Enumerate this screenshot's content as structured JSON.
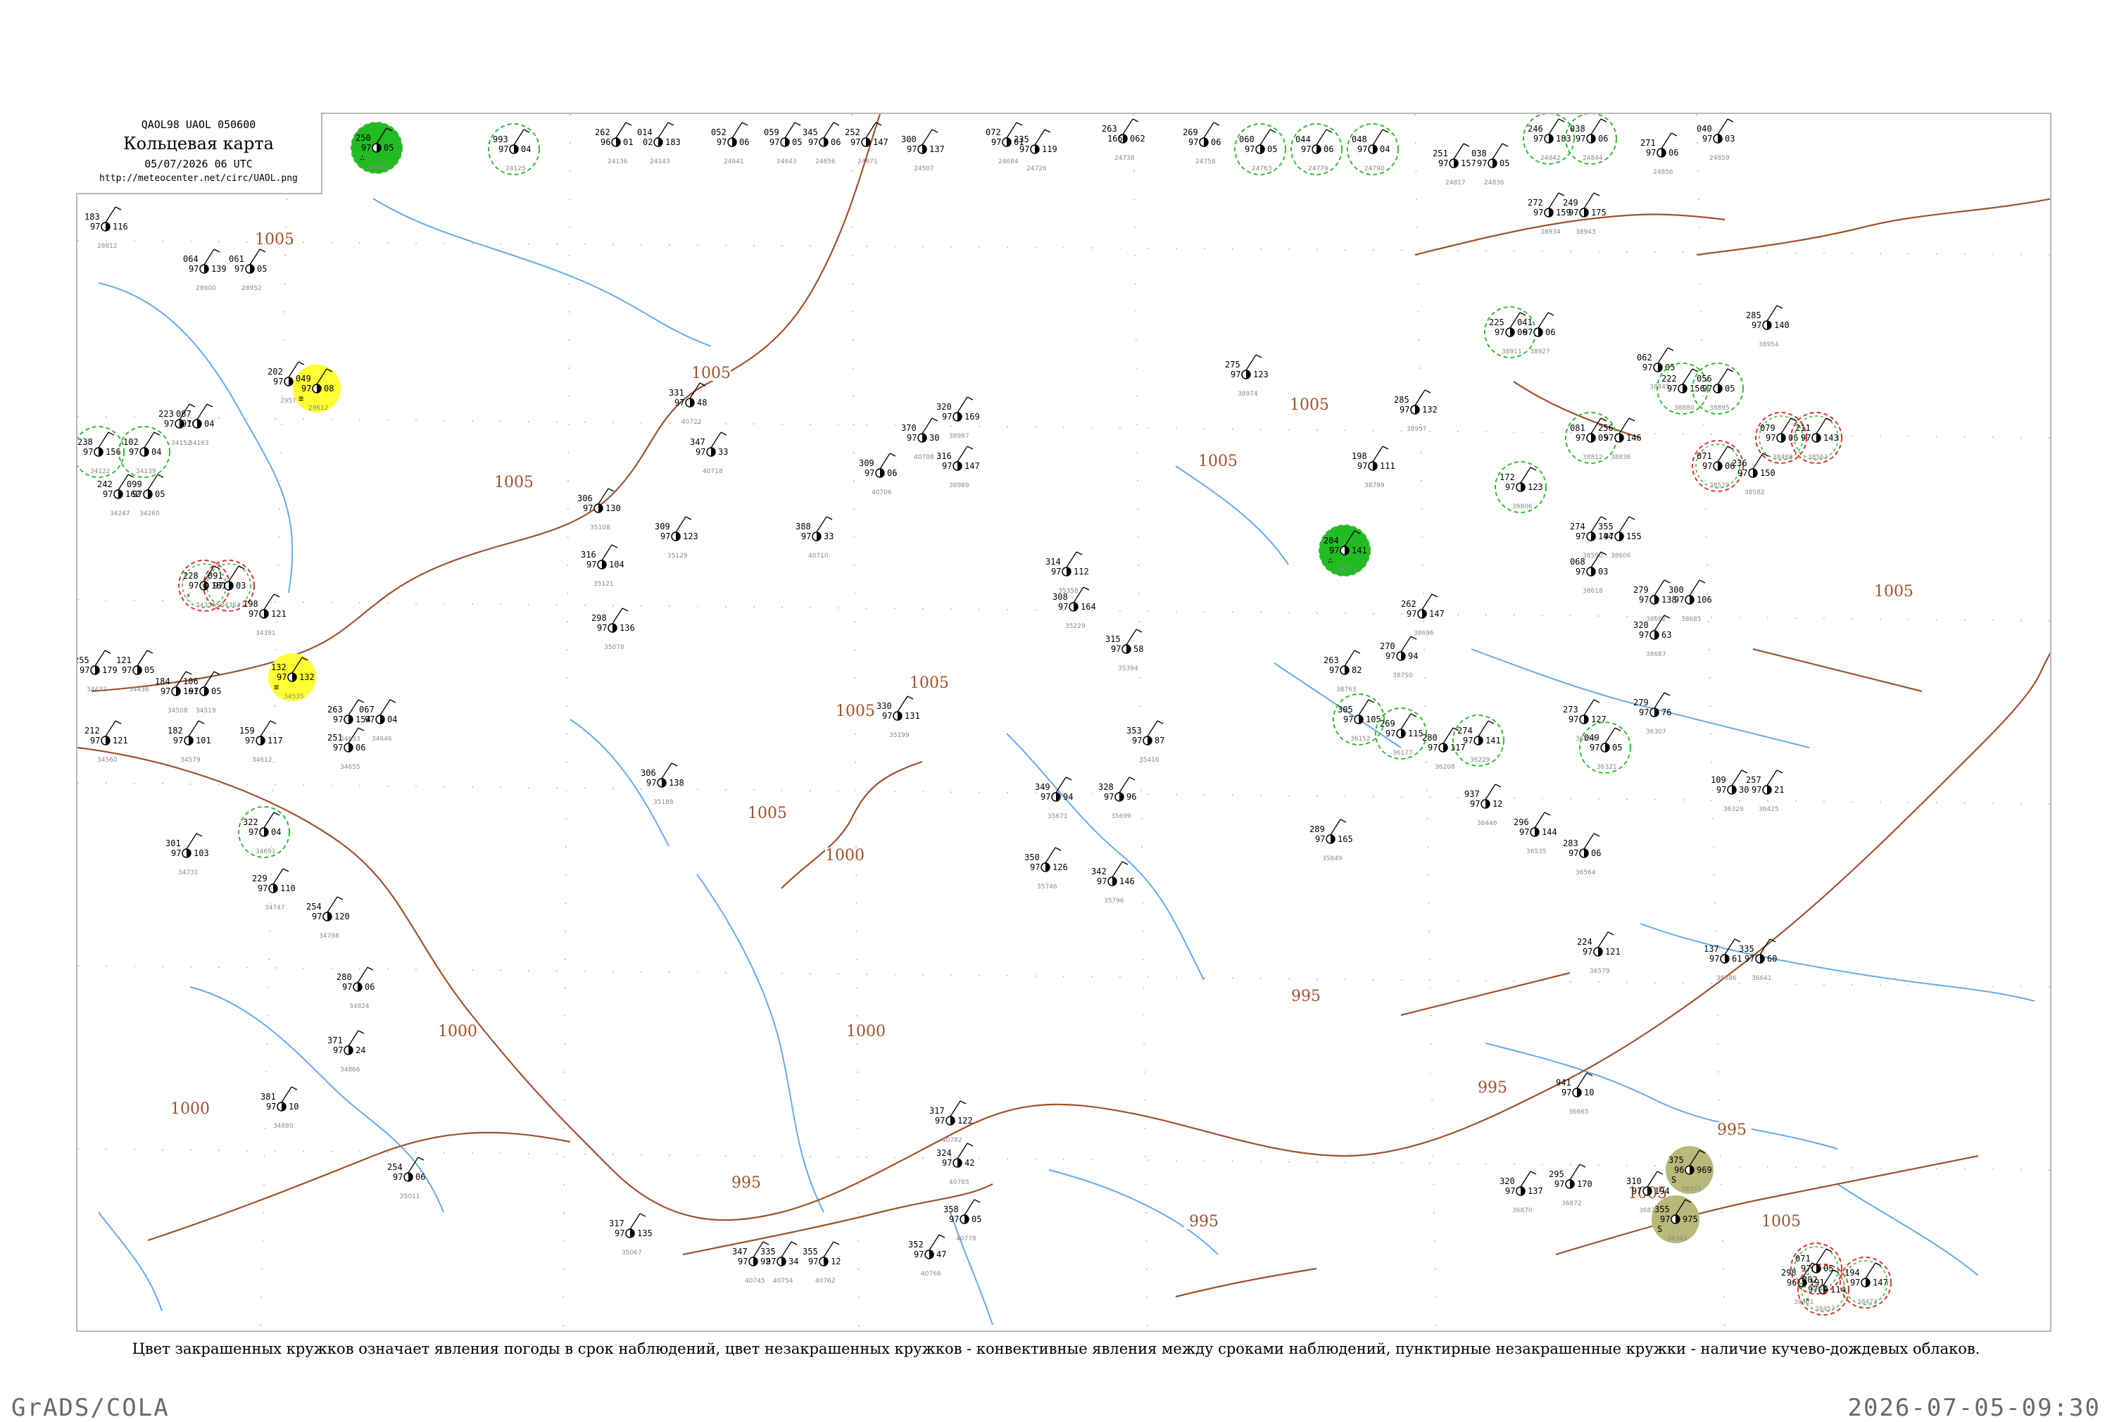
{
  "title": {
    "code": "QAOL98  UAOL  050600",
    "main": "Кольцевая карта",
    "time": "05/07/2026 06 UTC",
    "url": "http://meteocenter.net/circ/UAOL.png"
  },
  "caption": "Цвет закрашенных кружков означает явления погоды в срок наблюдений, цвет незакрашенных кружков - конвективные явления между сроками наблюдений, пунктирные незакрашенные кружки - наличие кучево-дождевых облаков.",
  "footer": {
    "left": "GrADS/COLA",
    "right": "2026-07-05-09:30"
  },
  "colors": {
    "rain_fill": "#22bb22",
    "convective_ring": "#33bb33",
    "thunder_ring": "#dd3333",
    "fog_fill": "#ffff33",
    "dust_fill": "#b8b87a",
    "isobar": "#a0522d",
    "river": "#66aaee",
    "frame": "#b8b8b8"
  },
  "isobar_labels": [
    "1005",
    "1005",
    "1005",
    "1005",
    "1005",
    "1005",
    "1005",
    "1005",
    "1005",
    "1000",
    "1000",
    "1000",
    "1000",
    "995",
    "995",
    "995",
    "995",
    "995",
    "1005",
    "1005"
  ],
  "stations": [
    {
      "p": "250",
      "t": "97",
      "v": "05",
      "id": "23955",
      "w": "rain",
      "kind": "rain"
    },
    {
      "p": "993",
      "t": "97",
      "v": "04",
      "id": "24125",
      "w": "",
      "kind": "conv"
    },
    {
      "p": "262",
      "t": "96",
      "v": "01",
      "id": "24136",
      "w": "",
      "kind": "none"
    },
    {
      "p": "014",
      "t": "02",
      "v": "183",
      "id": "24143",
      "w": "",
      "kind": "none"
    },
    {
      "p": "300",
      "t": "97",
      "v": "137",
      "id": "24507",
      "w": "",
      "kind": "none"
    },
    {
      "p": "052",
      "t": "97",
      "v": "06",
      "id": "24641",
      "w": "",
      "kind": "none"
    },
    {
      "p": "059",
      "t": "97",
      "v": "05",
      "id": "24643",
      "w": "",
      "kind": "none"
    },
    {
      "p": "345",
      "t": "97",
      "v": "06",
      "id": "24656",
      "w": "",
      "kind": "none"
    },
    {
      "p": "252",
      "t": "97",
      "v": "147",
      "id": "24671",
      "w": "",
      "kind": "none"
    },
    {
      "p": "072",
      "t": "97",
      "v": "01",
      "id": "24684",
      "w": "",
      "kind": "none"
    },
    {
      "p": "235",
      "t": "97",
      "v": "119",
      "id": "24726",
      "w": "",
      "kind": "none"
    },
    {
      "p": "263",
      "t": "166",
      "v": "062",
      "id": "24738",
      "w": "",
      "kind": "none"
    },
    {
      "p": "269",
      "t": "97",
      "v": "06",
      "id": "24758",
      "w": "",
      "kind": "none"
    },
    {
      "p": "060",
      "t": "97",
      "v": "05",
      "id": "24763",
      "w": "",
      "kind": "conv"
    },
    {
      "p": "044",
      "t": "97",
      "v": "06",
      "id": "24779",
      "w": "",
      "kind": "conv"
    },
    {
      "p": "048",
      "t": "97",
      "v": "04",
      "id": "24790",
      "w": "",
      "kind": "conv"
    },
    {
      "p": "251",
      "t": "97",
      "v": "157",
      "id": "24817",
      "w": "",
      "kind": "none"
    },
    {
      "p": "038",
      "t": "97",
      "v": "05",
      "id": "24836",
      "w": "",
      "kind": "none"
    },
    {
      "p": "246",
      "t": "97",
      "v": "183",
      "id": "24842",
      "w": "",
      "kind": "conv"
    },
    {
      "p": "038",
      "t": "97",
      "v": "06",
      "id": "24844",
      "w": "",
      "kind": "conv"
    },
    {
      "p": "271",
      "t": "97",
      "v": "06",
      "id": "24856",
      "w": "",
      "kind": "none"
    },
    {
      "p": "040",
      "t": "97",
      "v": "03",
      "id": "24859",
      "w": "",
      "kind": "none"
    },
    {
      "p": "183",
      "t": "97",
      "v": "116",
      "id": "28812",
      "w": "",
      "kind": "none"
    },
    {
      "p": "064",
      "t": "97",
      "v": "139",
      "id": "28900",
      "w": "",
      "kind": "none"
    },
    {
      "p": "061",
      "t": "97",
      "v": "05",
      "id": "28952",
      "w": "",
      "kind": "none"
    },
    {
      "p": "202",
      "t": "97",
      "v": "174",
      "id": "29573",
      "w": "",
      "kind": "none"
    },
    {
      "p": "049",
      "t": "97",
      "v": "08",
      "id": "29612",
      "w": "fog",
      "kind": "fog"
    },
    {
      "p": "238",
      "t": "97",
      "v": "156",
      "id": "34122",
      "w": "",
      "kind": "conv"
    },
    {
      "p": "102",
      "t": "97",
      "v": "04",
      "id": "34139",
      "w": "",
      "kind": "conv"
    },
    {
      "p": "223",
      "t": "97",
      "v": "160",
      "id": "34152",
      "w": "",
      "kind": "none"
    },
    {
      "p": "087",
      "t": "97",
      "v": "04",
      "id": "34163",
      "w": "",
      "kind": "none"
    },
    {
      "p": "242",
      "t": "97",
      "v": "162",
      "id": "34247",
      "w": "",
      "kind": "none"
    },
    {
      "p": "099",
      "t": "97",
      "v": "05",
      "id": "34260",
      "w": "",
      "kind": "none"
    },
    {
      "p": "228",
      "t": "97",
      "v": "181",
      "id": "34356",
      "w": "thunder",
      "kind": "thunder"
    },
    {
      "p": "091",
      "t": "97",
      "v": "03",
      "id": "34363",
      "w": "",
      "kind": "thunder"
    },
    {
      "p": "198",
      "t": "97",
      "v": "121",
      "id": "34391",
      "w": "",
      "kind": "none"
    },
    {
      "p": "255",
      "t": "97",
      "v": "179",
      "id": "34432",
      "w": "",
      "kind": "none"
    },
    {
      "p": "121",
      "t": "97",
      "v": "05",
      "id": "34436",
      "w": "",
      "kind": "none"
    },
    {
      "p": "184",
      "t": "97",
      "v": "161",
      "id": "34508",
      "w": "",
      "kind": "none"
    },
    {
      "p": "106",
      "t": "97",
      "v": "05",
      "id": "34519",
      "w": "",
      "kind": "none"
    },
    {
      "p": "132",
      "t": "97",
      "v": "132",
      "id": "34535",
      "w": "fog",
      "kind": "fog"
    },
    {
      "p": "212",
      "t": "97",
      "v": "121",
      "id": "34560",
      "w": "",
      "kind": "none"
    },
    {
      "p": "182",
      "t": "97",
      "v": "101",
      "id": "34579",
      "w": "",
      "kind": "none"
    },
    {
      "p": "159",
      "t": "97",
      "v": "117",
      "id": "34612",
      "w": "",
      "kind": "none"
    },
    {
      "p": "263",
      "t": "97",
      "v": "154",
      "id": "34633",
      "w": "",
      "kind": "none"
    },
    {
      "p": "067",
      "t": "97",
      "v": "04",
      "id": "34646",
      "w": "",
      "kind": "none"
    },
    {
      "p": "251",
      "t": "97",
      "v": "06",
      "id": "34655",
      "w": "",
      "kind": "none"
    },
    {
      "p": "322",
      "t": "97",
      "v": "04",
      "id": "34691",
      "w": "",
      "kind": "conv"
    },
    {
      "p": "301",
      "t": "97",
      "v": "103",
      "id": "34731",
      "w": "",
      "kind": "none"
    },
    {
      "p": "229",
      "t": "97",
      "v": "110",
      "id": "34747",
      "w": "",
      "kind": "none"
    },
    {
      "p": "254",
      "t": "97",
      "v": "120",
      "id": "34798",
      "w": "",
      "kind": "none"
    },
    {
      "p": "280",
      "t": "97",
      "v": "06",
      "id": "34824",
      "w": "",
      "kind": "none"
    },
    {
      "p": "371",
      "t": "97",
      "v": "24",
      "id": "34866",
      "w": "",
      "kind": "none"
    },
    {
      "p": "381",
      "t": "97",
      "v": "10",
      "id": "34880",
      "w": "",
      "kind": "none"
    },
    {
      "p": "254",
      "t": "97",
      "v": "06",
      "id": "35011",
      "w": "",
      "kind": "none"
    },
    {
      "p": "317",
      "t": "97",
      "v": "135",
      "id": "35067",
      "w": "",
      "kind": "none"
    },
    {
      "p": "298",
      "t": "97",
      "v": "136",
      "id": "35078",
      "w": "",
      "kind": "none"
    },
    {
      "p": "306",
      "t": "97",
      "v": "130",
      "id": "35108",
      "w": "",
      "kind": "none"
    },
    {
      "p": "316",
      "t": "97",
      "v": "104",
      "id": "35121",
      "w": "",
      "kind": "none"
    },
    {
      "p": "309",
      "t": "97",
      "v": "123",
      "id": "35129",
      "w": "",
      "kind": "none"
    },
    {
      "p": "306",
      "t": "97",
      "v": "138",
      "id": "35188",
      "w": "",
      "kind": "none"
    },
    {
      "p": "330",
      "t": "97",
      "v": "131",
      "id": "35199",
      "w": "",
      "kind": "none"
    },
    {
      "p": "308",
      "t": "97",
      "v": "164",
      "id": "35229",
      "w": "",
      "kind": "none"
    },
    {
      "p": "314",
      "t": "97",
      "v": "112",
      "id": "35358",
      "w": "",
      "kind": "none"
    },
    {
      "p": "315",
      "t": "97",
      "v": "58",
      "id": "35394",
      "w": "",
      "kind": "none"
    },
    {
      "p": "353",
      "t": "97",
      "v": "87",
      "id": "35416",
      "w": "",
      "kind": "none"
    },
    {
      "p": "349",
      "t": "97",
      "v": "94",
      "id": "35671",
      "w": "",
      "kind": "none"
    },
    {
      "p": "328",
      "t": "97",
      "v": "96",
      "id": "35699",
      "w": "",
      "kind": "none"
    },
    {
      "p": "350",
      "t": "97",
      "v": "126",
      "id": "35746",
      "w": "",
      "kind": "none"
    },
    {
      "p": "342",
      "t": "97",
      "v": "146",
      "id": "35796",
      "w": "",
      "kind": "none"
    },
    {
      "p": "289",
      "t": "97",
      "v": "165",
      "id": "35849",
      "w": "",
      "kind": "none"
    },
    {
      "p": "305",
      "t": "97",
      "v": "105",
      "id": "36152",
      "w": "",
      "kind": "conv"
    },
    {
      "p": "269",
      "t": "97",
      "v": "115",
      "id": "36177",
      "w": "",
      "kind": "conv"
    },
    {
      "p": "280",
      "t": "97",
      "v": "117",
      "id": "36208",
      "w": "",
      "kind": "none"
    },
    {
      "p": "274",
      "t": "97",
      "v": "141",
      "id": "36229",
      "w": "",
      "kind": "conv"
    },
    {
      "p": "273",
      "t": "97",
      "v": "127",
      "id": "36259",
      "w": "",
      "kind": "none"
    },
    {
      "p": "279",
      "t": "97",
      "v": "76",
      "id": "36307",
      "w": "",
      "kind": "none"
    },
    {
      "p": "049",
      "t": "97",
      "v": "05",
      "id": "36321",
      "w": "",
      "kind": "conv"
    },
    {
      "p": "109",
      "t": "97",
      "v": "30",
      "id": "36329",
      "w": "",
      "kind": "none"
    },
    {
      "p": "257",
      "t": "97",
      "v": "21",
      "id": "36425",
      "w": "",
      "kind": "none"
    },
    {
      "p": "937",
      "t": "97",
      "v": "12",
      "id": "36446",
      "w": "",
      "kind": "none"
    },
    {
      "p": "296",
      "t": "97",
      "v": "144",
      "id": "36535",
      "w": "",
      "kind": "none"
    },
    {
      "p": "283",
      "t": "97",
      "v": "06",
      "id": "36564",
      "w": "",
      "kind": "none"
    },
    {
      "p": "224",
      "t": "97",
      "v": "121",
      "id": "36579",
      "w": "",
      "kind": "none"
    },
    {
      "p": "137",
      "t": "97",
      "v": "61",
      "id": "36586",
      "w": "",
      "kind": "none"
    },
    {
      "p": "335",
      "t": "97",
      "v": "60",
      "id": "36641",
      "w": "",
      "kind": "none"
    },
    {
      "p": "941",
      "t": "97",
      "v": "10",
      "id": "36665",
      "w": "",
      "kind": "none"
    },
    {
      "p": "320",
      "t": "97",
      "v": "137",
      "id": "36870",
      "w": "",
      "kind": "none"
    },
    {
      "p": "295",
      "t": "97",
      "v": "170",
      "id": "36872",
      "w": "",
      "kind": "none"
    },
    {
      "p": "310",
      "t": "97",
      "v": "194",
      "id": "36879",
      "w": "",
      "kind": "none"
    },
    {
      "p": "355",
      "t": "97",
      "v": "975",
      "id": "38341",
      "w": "dust",
      "kind": "dust"
    },
    {
      "p": "375",
      "t": "96",
      "v": "969",
      "id": "38353",
      "w": "dust",
      "kind": "dust"
    },
    {
      "p": "298",
      "t": "96",
      "v": "191",
      "id": "38401",
      "w": "",
      "kind": "none"
    },
    {
      "p": "202",
      "t": "97",
      "v": "114",
      "id": "38457",
      "w": "thunder",
      "kind": "thunder"
    },
    {
      "p": "071",
      "t": "97",
      "v": "05",
      "id": "38469",
      "w": "",
      "kind": "thunder"
    },
    {
      "p": "194",
      "t": "97",
      "v": "147",
      "id": "38473",
      "w": "",
      "kind": "thunder"
    },
    {
      "p": "079",
      "t": "97",
      "v": "06",
      "id": "38488",
      "w": "",
      "kind": "thunder"
    },
    {
      "p": "211",
      "t": "97",
      "v": "143",
      "id": "38562",
      "w": "",
      "kind": "thunder"
    },
    {
      "p": "071",
      "t": "97",
      "v": "06",
      "id": "38579",
      "w": "",
      "kind": "thunder"
    },
    {
      "p": "236",
      "t": "97",
      "v": "150",
      "id": "38582",
      "w": "",
      "kind": "none"
    },
    {
      "p": "274",
      "t": "97",
      "v": "144",
      "id": "38590",
      "w": "",
      "kind": "none"
    },
    {
      "p": "355",
      "t": "97",
      "v": "155",
      "id": "38606",
      "w": "",
      "kind": "none"
    },
    {
      "p": "068",
      "t": "97",
      "v": "03",
      "id": "38618",
      "w": "",
      "kind": "none"
    },
    {
      "p": "279",
      "t": "97",
      "v": "138",
      "id": "38682",
      "w": "",
      "kind": "none"
    },
    {
      "p": "300",
      "t": "97",
      "v": "106",
      "id": "38685",
      "w": "",
      "kind": "none"
    },
    {
      "p": "320",
      "t": "97",
      "v": "63",
      "id": "38687",
      "w": "",
      "kind": "none"
    },
    {
      "p": "262",
      "t": "97",
      "v": "147",
      "id": "38696",
      "w": "",
      "kind": "none"
    },
    {
      "p": "270",
      "t": "97",
      "v": "94",
      "id": "38750",
      "w": "",
      "kind": "none"
    },
    {
      "p": "263",
      "t": "97",
      "v": "82",
      "id": "38763",
      "w": "",
      "kind": "none"
    },
    {
      "p": "204",
      "t": "97",
      "v": "141",
      "id": "38773",
      "w": "rain",
      "kind": "rain"
    },
    {
      "p": "198",
      "t": "97",
      "v": "111",
      "id": "38799",
      "w": "",
      "kind": "none"
    },
    {
      "p": "172",
      "t": "97",
      "v": "123",
      "id": "38806",
      "w": "",
      "kind": "conv"
    },
    {
      "p": "081",
      "t": "97",
      "v": "05",
      "id": "38812",
      "w": "",
      "kind": "conv"
    },
    {
      "p": "256",
      "t": "97",
      "v": "146",
      "id": "38836",
      "w": "",
      "kind": "none"
    },
    {
      "p": "062",
      "t": "97",
      "v": "05",
      "id": "38845",
      "w": "",
      "kind": "none"
    },
    {
      "p": "222",
      "t": "97",
      "v": "156",
      "id": "38880",
      "w": "",
      "kind": "conv"
    },
    {
      "p": "056",
      "t": "97",
      "v": "05",
      "id": "38895",
      "w": "",
      "kind": "conv"
    },
    {
      "p": "225",
      "t": "97",
      "v": "06",
      "id": "38911",
      "w": "",
      "kind": "conv"
    },
    {
      "p": "041",
      "t": "97",
      "v": "06",
      "id": "38927",
      "w": "",
      "kind": "none"
    },
    {
      "p": "272",
      "t": "97",
      "v": "159",
      "id": "38934",
      "w": "",
      "kind": "none"
    },
    {
      "p": "249",
      "t": "97",
      "v": "175",
      "id": "38943",
      "w": "",
      "kind": "none"
    },
    {
      "p": "285",
      "t": "97",
      "v": "140",
      "id": "38954",
      "w": "",
      "kind": "none"
    },
    {
      "p": "285",
      "t": "97",
      "v": "132",
      "id": "38957",
      "w": "",
      "kind": "none"
    },
    {
      "p": "275",
      "t": "97",
      "v": "123",
      "id": "38974",
      "w": "",
      "kind": "none"
    },
    {
      "p": "320",
      "t": "97",
      "v": "169",
      "id": "38987",
      "w": "",
      "kind": "none"
    },
    {
      "p": "316",
      "t": "97",
      "v": "147",
      "id": "38989",
      "w": "",
      "kind": "none"
    },
    {
      "p": "309",
      "t": "97",
      "v": "06",
      "id": "40706",
      "w": "",
      "kind": "none"
    },
    {
      "p": "370",
      "t": "97",
      "v": "30",
      "id": "40708",
      "w": "",
      "kind": "none"
    },
    {
      "p": "388",
      "t": "97",
      "v": "33",
      "id": "40710",
      "w": "",
      "kind": "none"
    },
    {
      "p": "347",
      "t": "97",
      "v": "33",
      "id": "40718",
      "w": "",
      "kind": "none"
    },
    {
      "p": "331",
      "t": "97",
      "v": "48",
      "id": "40722",
      "w": "",
      "kind": "none"
    },
    {
      "p": "347",
      "t": "97",
      "v": "92",
      "id": "40745",
      "w": "",
      "kind": "none"
    },
    {
      "p": "335",
      "t": "97",
      "v": "34",
      "id": "40754",
      "w": "",
      "kind": "none"
    },
    {
      "p": "355",
      "t": "97",
      "v": "12",
      "id": "40762",
      "w": "",
      "kind": "none"
    },
    {
      "p": "352",
      "t": "97",
      "v": "47",
      "id": "40766",
      "w": "",
      "kind": "none"
    },
    {
      "p": "358",
      "t": "97",
      "v": "05",
      "id": "40778",
      "w": "",
      "kind": "none"
    },
    {
      "p": "317",
      "t": "97",
      "v": "122",
      "id": "40782",
      "w": "",
      "kind": "none"
    },
    {
      "p": "324",
      "t": "97",
      "v": "42",
      "id": "40785",
      "w": "",
      "kind": "none"
    }
  ]
}
